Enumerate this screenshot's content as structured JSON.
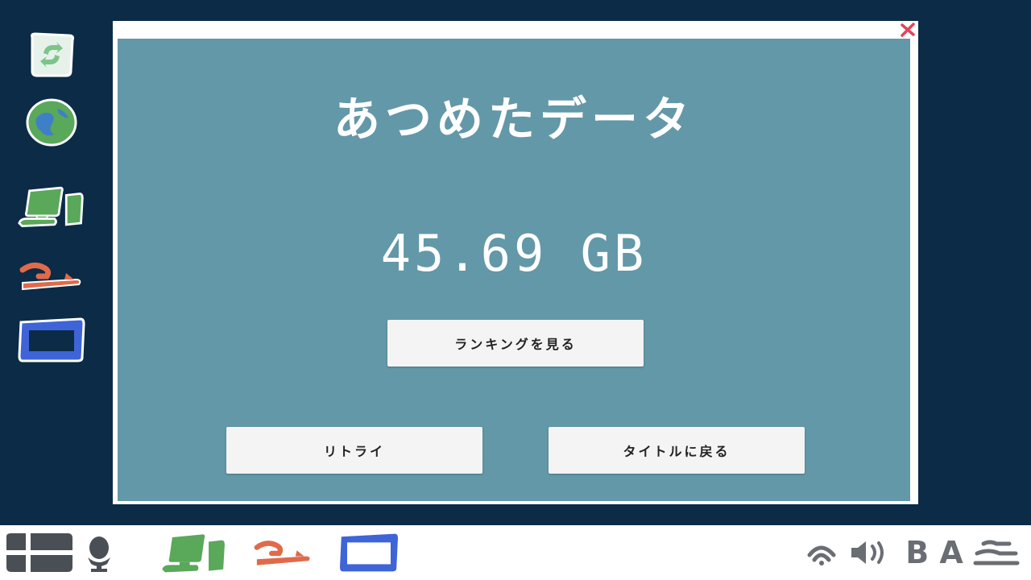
{
  "dialog": {
    "title": "あつめたデータ",
    "value": "45.69 GB",
    "buttons": {
      "ranking": "ランキングを見る",
      "retry": "リトライ",
      "back_to_title": "タイトルに戻る"
    }
  },
  "desktop_icons": [
    "recycle-icon",
    "globe-icon",
    "computer-icon",
    "plane-icon",
    "window-icon"
  ],
  "taskbar": {
    "left_icons": [
      "start-icon",
      "search-icon",
      "computer-icon",
      "plane-icon",
      "window-icon"
    ],
    "tray_text": "B A"
  },
  "colors": {
    "desktop_bg": "#0b2b47",
    "dialog_bg": "#6398a8",
    "close_red": "#e0445a",
    "green": "#5aa85a",
    "red": "#e06a4a",
    "blue": "#3f64d8"
  }
}
